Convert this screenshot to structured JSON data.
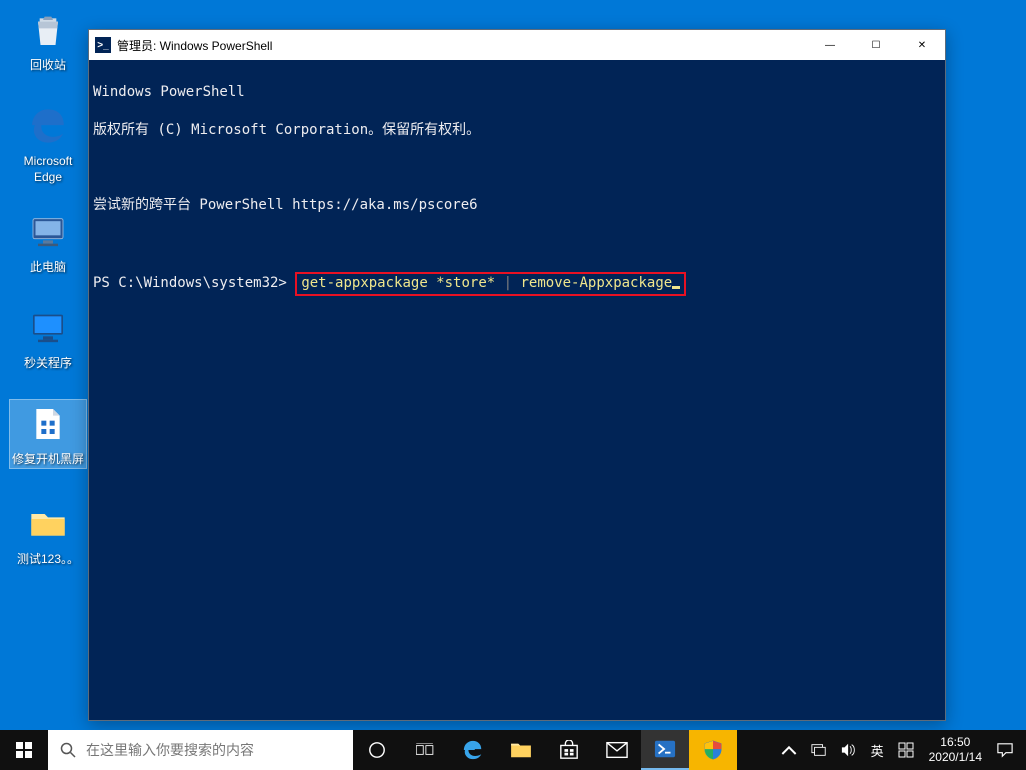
{
  "desktop": {
    "icons": [
      {
        "label": "回收站"
      },
      {
        "label": "Microsoft\nEdge"
      },
      {
        "label": "此电脑"
      },
      {
        "label": "秒关程序"
      },
      {
        "label": "修复开机黑屏"
      },
      {
        "label": "测试123。。"
      }
    ]
  },
  "powershell": {
    "title": "管理员: Windows PowerShell",
    "line1": "Windows PowerShell",
    "line2": "版权所有 (C) Microsoft Corporation。保留所有权利。",
    "line3": "尝试新的跨平台 PowerShell https://aka.ms/pscore6",
    "prompt": "PS C:\\Windows\\system32>",
    "cmd_part1": "get-appxpackage *store*",
    "cmd_pipe": " | ",
    "cmd_part2": "remove-Appxpackage"
  },
  "taskbar": {
    "search_placeholder": "在这里输入你要搜索的内容",
    "ime": "英",
    "time": "16:50",
    "date": "2020/1/14"
  },
  "window_controls": {
    "minimize": "—",
    "maximize": "☐",
    "close": "✕"
  }
}
